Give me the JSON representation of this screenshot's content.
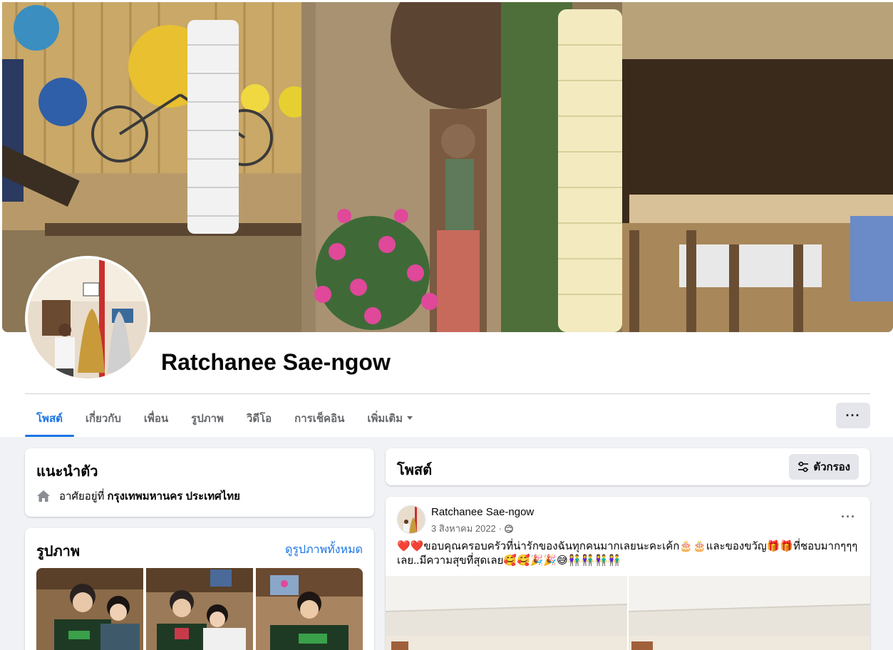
{
  "profile": {
    "name": "Ratchanee Sae-ngow"
  },
  "tabs": [
    {
      "label": "โพสต์",
      "active": true
    },
    {
      "label": "เกี่ยวกับ"
    },
    {
      "label": "เพื่อน"
    },
    {
      "label": "รูปภาพ"
    },
    {
      "label": "วิดีโอ"
    },
    {
      "label": "การเช็คอิน"
    },
    {
      "label": "เพิ่มเติม"
    }
  ],
  "more_button": "···",
  "intro": {
    "title": "แนะนำตัว",
    "lives_prefix": "อาศัยอยู่ที่",
    "lives_place": "กรุงเทพมหานคร ประเทศไทย"
  },
  "photos": {
    "title": "รูปภาพ",
    "see_all": "ดูรูปภาพทั้งหมด"
  },
  "posts_header": {
    "title": "โพสต์",
    "filter_label": "ตัวกรอง"
  },
  "post": {
    "author": "Ratchanee Sae-ngow",
    "date": "3 สิงหาคม 2022",
    "dot": "·",
    "more": "···",
    "text": "❤️❤️ขอบคุณครอบครัวที่น่ารักของฉันทุกคนมากเลยนะคะเค้ก🎂🎂และของขวัญ🎁🎁ที่ชอบมากๆๆๆเลย..มีความสุขที่สุดเลย🥰🥰🎉🎉😅👫👫👫👫"
  },
  "colors": {
    "accent": "#1b74e4",
    "background": "#f0f2f5",
    "secondary_text": "#65676b"
  }
}
